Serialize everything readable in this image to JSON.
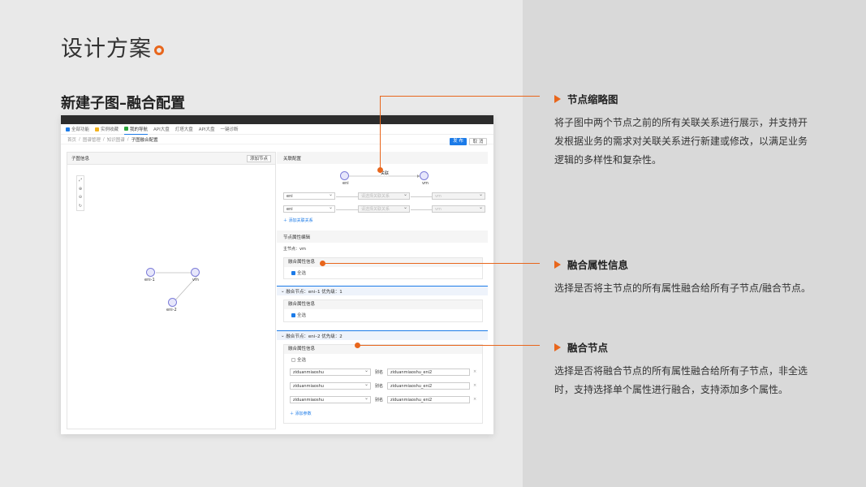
{
  "slide": {
    "title": "设计方案",
    "section": "新建子图–融合配置"
  },
  "nav": {
    "items": [
      "全部功能",
      "实例收藏",
      "我的导航",
      "API大盘",
      "灯塔大盘",
      "API大盘",
      "一键诊断"
    ]
  },
  "breadcrumb": [
    "首页",
    "图谱管理",
    "知识图谱",
    "子图融合配置"
  ],
  "actions": {
    "publish": "发 布",
    "cancel": "取 消"
  },
  "left": {
    "title": "子图信息",
    "add_node": "添加节点",
    "nodes": [
      "eni-1",
      "vm",
      "eni-2"
    ],
    "tools": [
      "⤢",
      "⊕",
      "⊖",
      "↻"
    ]
  },
  "right": {
    "rel_title": "关联配置",
    "rel_graph": {
      "from": "eni",
      "to": "vm",
      "label": "关联"
    },
    "rel_rows": [
      {
        "from": "eni",
        "relation": "请选择关联关系",
        "to": "vm"
      },
      {
        "from": "eni",
        "relation": "请选择关联关系",
        "to": "vm"
      }
    ],
    "add_relation": "添加关联关系",
    "attr_title": "节点属性编辑",
    "main_node": "主节点：vm",
    "merge_info": "融合属性信息",
    "select_all": "全选",
    "node1": "融合节点：eni–1   优先级：1",
    "node2": "融合节点：eni–2   优先级：2",
    "fields": [
      {
        "field": "ziduanmiaoshu",
        "alias_label": "别名",
        "alias": "ziduanmiaoshu_eni2"
      },
      {
        "field": "ziduanmiaoshu",
        "alias_label": "别名",
        "alias": "ziduanmiaoshu_eni2"
      },
      {
        "field": "ziduanmiaoshu",
        "alias_label": "别名",
        "alias": "ziduanmiaoshu_eni2"
      }
    ],
    "add_param": "添加参数"
  },
  "annotations": [
    {
      "title": "节点缩略图",
      "body": "将子图中两个节点之前的所有关联关系进行展示，并支持开发根据业务的需求对关联关系进行新建或修改，以满足业务逻辑的多样性和复杂性。"
    },
    {
      "title": "融合属性信息",
      "body": "选择是否将主节点的所有属性融合给所有子节点/融合节点。"
    },
    {
      "title": "融合节点",
      "body": "选择是否将融合节点的所有属性融合给所有子节点，非全选时，支持选择单个属性进行融合，支持添加多个属性。"
    }
  ],
  "colors": {
    "accent": "#e8661c",
    "primary": "#1c7be8"
  }
}
